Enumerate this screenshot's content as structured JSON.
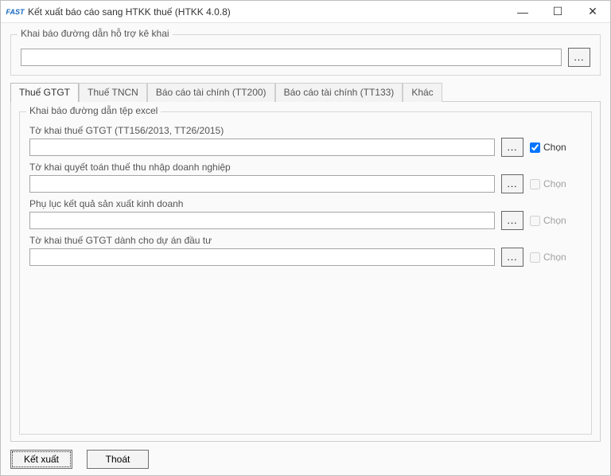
{
  "titlebar": {
    "app_icon_text": "FAST",
    "title": "Kết xuất báo cáo sang HTKK thuế (HTKK 4.0.8)"
  },
  "top_group": {
    "legend": "Khai báo đường dẫn hỗ trợ kê khai",
    "path_value": "",
    "browse_label": "..."
  },
  "tabs": [
    {
      "label": "Thuế GTGT",
      "active": true
    },
    {
      "label": "Thuế TNCN",
      "active": false
    },
    {
      "label": "Báo cáo tài chính (TT200)",
      "active": false
    },
    {
      "label": "Báo cáo tài chính (TT133)",
      "active": false
    },
    {
      "label": "Khác",
      "active": false
    }
  ],
  "excel_group": {
    "legend": "Khai báo đường dẫn tệp excel",
    "rows": [
      {
        "label": "Tờ khai thuế GTGT (TT156/2013, TT26/2015)",
        "value": "",
        "browse": "...",
        "chk_label": "Chọn",
        "checked": true,
        "enabled": true
      },
      {
        "label": "Tờ khai quyết toán thuế thu nhập doanh nghiệp",
        "value": "",
        "browse": "...",
        "chk_label": "Chọn",
        "checked": false,
        "enabled": false
      },
      {
        "label": "Phụ lục kết quả sản xuất kinh doanh",
        "value": "",
        "browse": "...",
        "chk_label": "Chọn",
        "checked": false,
        "enabled": false
      },
      {
        "label": "Tờ khai thuế GTGT dành cho dự án đầu tư",
        "value": "",
        "browse": "...",
        "chk_label": "Chọn",
        "checked": false,
        "enabled": false
      }
    ]
  },
  "footer": {
    "export_label": "Kết xuất",
    "exit_label": "Thoát"
  },
  "window_controls": {
    "minimize": "—",
    "maximize": "☐",
    "close": "✕"
  }
}
